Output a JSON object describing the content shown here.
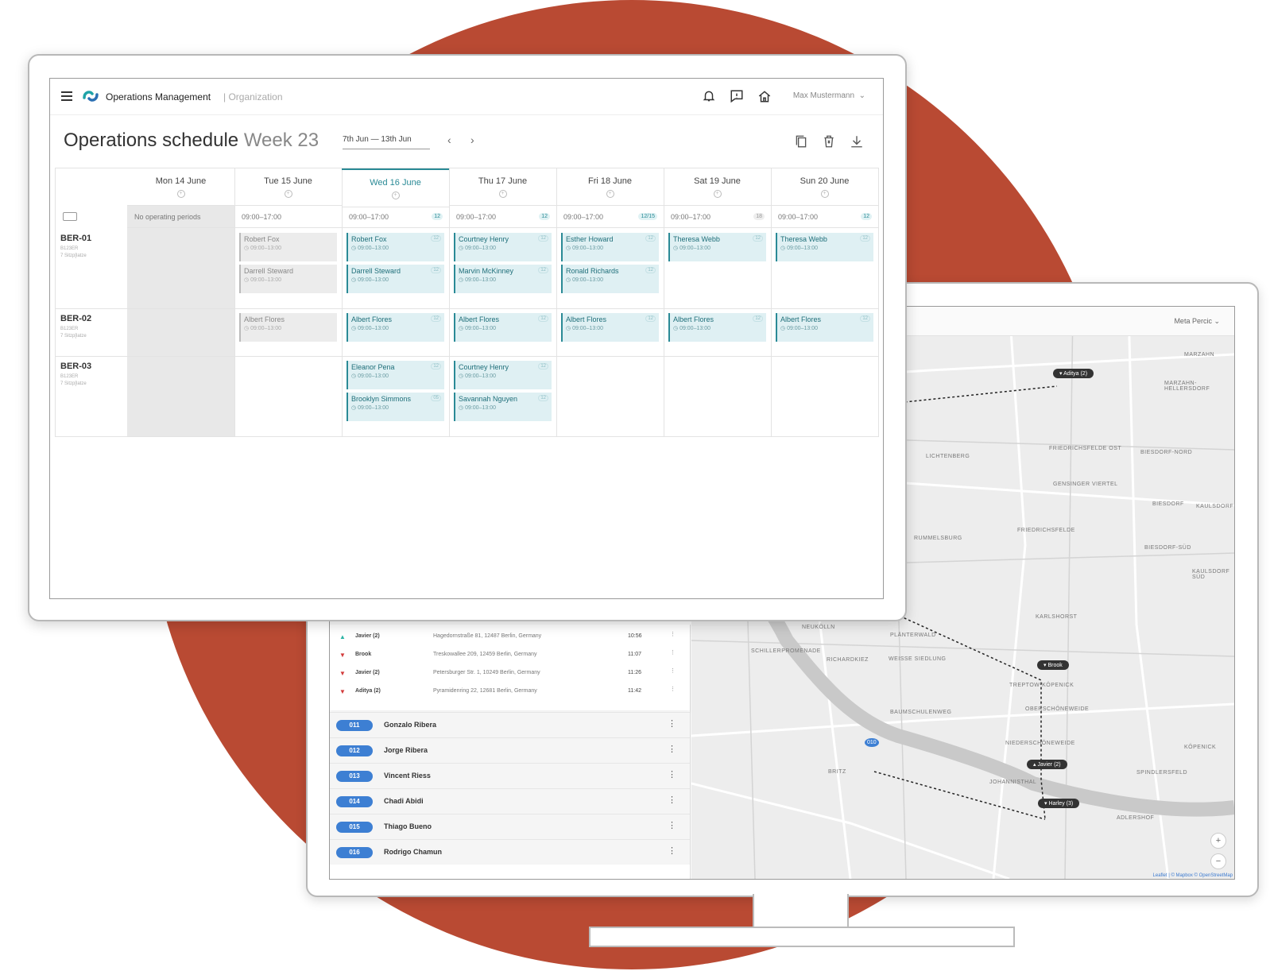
{
  "schedule": {
    "app_name": "Operations Management",
    "org_name": "| Organization",
    "user": "Max Mustermann",
    "title": "Operations schedule",
    "week": "Week 23",
    "range": "7th Jun — 13th Jun",
    "no_ops": "No operating periods",
    "days": [
      {
        "label": "Mon 14  June",
        "hours": "",
        "count": ""
      },
      {
        "label": "Tue 15 June",
        "hours": "09:00–17:00",
        "count": ""
      },
      {
        "label": "Wed 16 June",
        "hours": "09:00–17:00",
        "count": "12"
      },
      {
        "label": "Thu 17 June",
        "hours": "09:00–17:00",
        "count": "12"
      },
      {
        "label": "Fri 18 June",
        "hours": "09:00–17:00",
        "count": "12/15"
      },
      {
        "label": "Sat 19 June",
        "hours": "09:00–17:00",
        "count": "18"
      },
      {
        "label": "Sun 20 June",
        "hours": "09:00–17:00",
        "count": "12"
      }
    ],
    "vehicles": [
      {
        "id": "BER-01",
        "plate": "B123ER",
        "seats": "7 Sitzp[latze"
      },
      {
        "id": "BER-02",
        "plate": "B123ER",
        "seats": "7 Sitzp[latze"
      },
      {
        "id": "BER-03",
        "plate": "B123ER",
        "seats": "7 Sitzp[latze"
      }
    ],
    "shift_time": "09:00–13:00",
    "shifts": {
      "r1": [
        [],
        [
          {
            "n": "Robert Fox",
            "c": ""
          },
          {
            "n": "Darrell Steward",
            "c": ""
          }
        ],
        [
          {
            "n": "Robert Fox",
            "c": "12"
          },
          {
            "n": "Darrell Steward",
            "c": "12"
          }
        ],
        [
          {
            "n": "Courtney Henry",
            "c": "12"
          },
          {
            "n": "Marvin McKinney",
            "c": "12"
          }
        ],
        [
          {
            "n": "Esther Howard",
            "c": "12"
          },
          {
            "n": "Ronald Richards",
            "c": "12"
          }
        ],
        [
          {
            "n": "Theresa Webb",
            "c": "12"
          }
        ],
        [
          {
            "n": "Theresa Webb",
            "c": "12"
          }
        ]
      ],
      "r2": [
        [],
        [
          {
            "n": "Albert Flores",
            "c": ""
          }
        ],
        [
          {
            "n": "Albert Flores",
            "c": "12"
          }
        ],
        [
          {
            "n": "Albert Flores",
            "c": "12"
          }
        ],
        [
          {
            "n": "Albert Flores",
            "c": "12"
          }
        ],
        [
          {
            "n": "Albert Flores",
            "c": "12"
          }
        ],
        [
          {
            "n": "Albert Flores",
            "c": "12"
          }
        ]
      ],
      "r3": [
        [],
        [],
        [
          {
            "n": "Eleanor Pena",
            "c": "12"
          },
          {
            "n": "Brooklyn Simmons",
            "c": "05"
          }
        ],
        [
          {
            "n": "Courtney Henry",
            "c": "12"
          },
          {
            "n": "Savannah Nguyen",
            "c": "12"
          }
        ],
        [],
        [],
        []
      ]
    }
  },
  "dispatch": {
    "user": "Meta Percic",
    "stops": [
      {
        "dir": "up",
        "name": "Javier (2)",
        "addr": "Hagedornstraße 81, 12487 Berlin, Germany",
        "time": "10:56"
      },
      {
        "dir": "down",
        "name": "Brook",
        "addr": "Treskowallee 209, 12459 Berlin, Germany",
        "time": "11:07"
      },
      {
        "dir": "down",
        "name": "Javier (2)",
        "addr": "Petersburger Str. 1, 10249 Berlin, Germany",
        "time": "11:26"
      },
      {
        "dir": "down",
        "name": "Aditya (2)",
        "addr": "Pyramidenring 22, 12681 Berlin, Germany",
        "time": "11:42"
      }
    ],
    "drivers": [
      {
        "badge": "011",
        "name": "Gonzalo Ribera"
      },
      {
        "badge": "012",
        "name": "Jorge Ribera"
      },
      {
        "badge": "013",
        "name": "Vincent Riess"
      },
      {
        "badge": "014",
        "name": "Chadi Abidi"
      },
      {
        "badge": "015",
        "name": "Thiago Bueno"
      },
      {
        "badge": "016",
        "name": "Rodrigo Chamun"
      }
    ],
    "map": {
      "markers": [
        "Aditya (2)",
        "Brook",
        "Javier (2)",
        "Harley (3)"
      ],
      "vehicle_badge": "010",
      "labels": [
        "MARZAHN",
        "MARZAHN-HELLERSDORF",
        "LICHTENBERG",
        "FRIEDRICHSFELDE OST",
        "BIESDORF-NORD",
        "GENSINGER VIERTEL",
        "BIESDORF",
        "KAULSDORF",
        "FRIEDRICHSFELDE",
        "RUMMELSBURG",
        "BIESDORF-SÜD",
        "KAULSDORF SÜD",
        "KARLSHORST",
        "NEUKÖLLN",
        "PLÄNTERWALD",
        "SCHILLERPROMENADE",
        "RICHARDKIEZ",
        "WEISSE SIEDLUNG",
        "TREPTOW-KÖPENICK",
        "BAUMSCHULENWEG",
        "OBERSCHÖNEWEIDE",
        "NIEDERSCHÖNEWEIDE",
        "KÖPENICK",
        "BRITZ",
        "JOHANNISTHAL",
        "SPINDLERSFELD",
        "ADLERSHOF"
      ],
      "attribution": "Leaflet | © Mapbox © OpenStreetMap"
    }
  }
}
